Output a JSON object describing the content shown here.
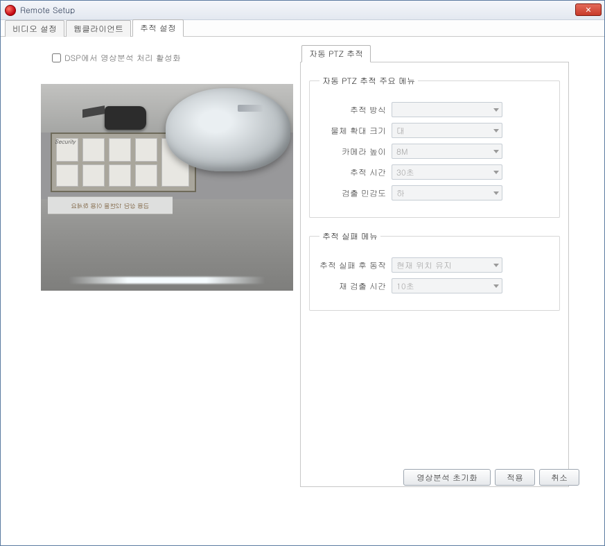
{
  "window": {
    "title": "Remote Setup"
  },
  "tabs": [
    {
      "label": "비디오 설정"
    },
    {
      "label": "웹클라이언트"
    },
    {
      "label": "추적 설정"
    }
  ],
  "active_tab_index": 2,
  "dsp_checkbox": {
    "label": "DSP에서 영상분석 처리 활성화",
    "checked": false
  },
  "inner_tab": {
    "label": "자동 PTZ 추적"
  },
  "group_main": {
    "legend": "자동 PTZ 추적 주요 메뉴",
    "rows": [
      {
        "label": "추적 방식",
        "value": ""
      },
      {
        "label": "물체 확대 크기",
        "value": "대"
      },
      {
        "label": "카메라 높이",
        "value": "8M"
      },
      {
        "label": "추적 시간",
        "value": "30초"
      },
      {
        "label": "검출 민감도",
        "value": "하"
      }
    ]
  },
  "group_fail": {
    "legend": "추적 실패 메뉴",
    "rows": [
      {
        "label": "추적 실패 후 동작",
        "value": "현재 위치 유지"
      },
      {
        "label": "재 검출 시간",
        "value": "10초"
      }
    ]
  },
  "buttons": {
    "reset": "영상분석 초기화",
    "apply": "적용",
    "cancel": "취소"
  },
  "video_overlay": {
    "security_label": "Security",
    "banner_text": "금융 상담 12번을 이용 하세요"
  }
}
